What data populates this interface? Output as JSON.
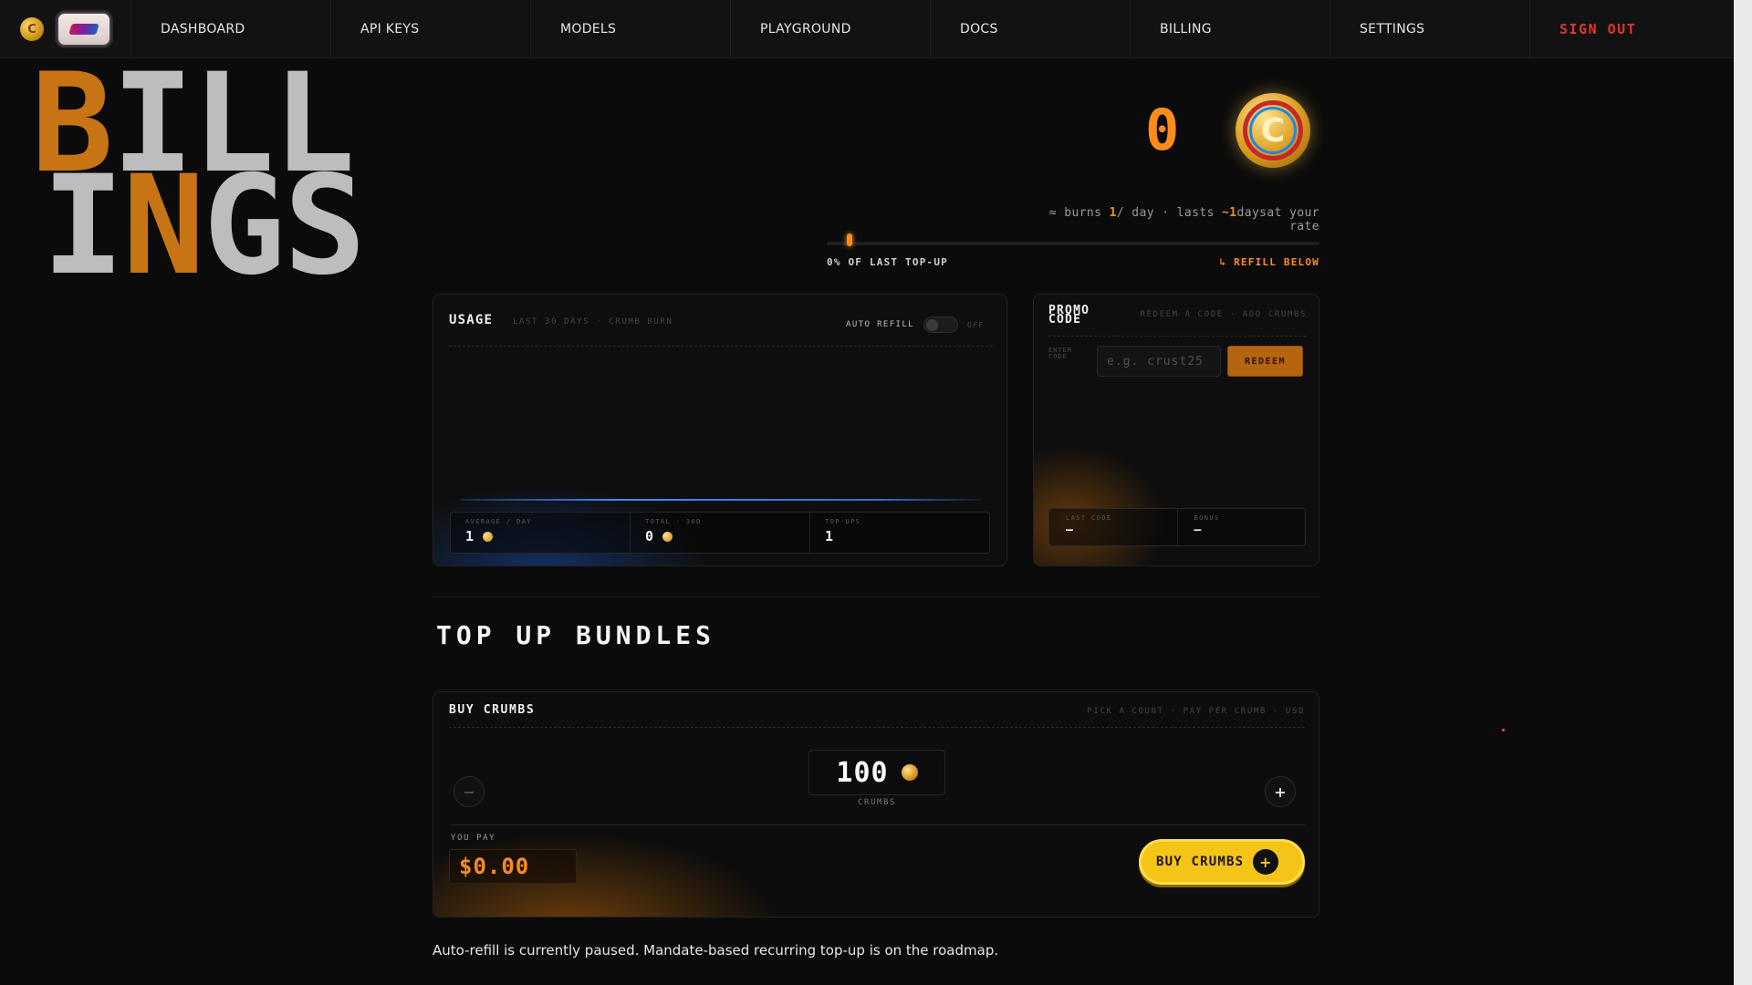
{
  "nav": {
    "items": [
      "DASHBOARD",
      "API KEYS",
      "MODELS",
      "PLAYGROUND",
      "DOCS",
      "BILLING",
      "SETTINGS"
    ],
    "signout": "SIGN OUT",
    "coin_icon": "C"
  },
  "hero": {
    "line1": "BILL",
    "line2": "INGS",
    "accent_color": "#c77414"
  },
  "balance": {
    "value": "0",
    "coin_letter": "C",
    "burn_prefix": "≈ burns ",
    "burn_rate": "1",
    "burn_mid": "/ day · lasts ",
    "lasts_days": "~1",
    "burn_suffix": "daysat your rate",
    "progress_percent": 0,
    "progress_left": "0% OF LAST TOP-UP",
    "progress_right": "↳ REFILL BELOW"
  },
  "usage": {
    "title": "USAGE",
    "subtitle": "LAST 30 DAYS · CRUMB BURN",
    "auto_refill_label": "AUTO REFILL",
    "auto_refill_state": "OFF",
    "stats": [
      {
        "label": "AVERAGE / DAY",
        "value": "1"
      },
      {
        "label": "TOTAL · 30D",
        "value": "0"
      },
      {
        "label": "TOP-UPS",
        "value": "1"
      }
    ]
  },
  "promo": {
    "title": "PROMO CODE",
    "subtitle": "REDEEM A CODE · ADD CRUMBS",
    "input_label": "ENTER CODE",
    "placeholder": "e.g. crust25",
    "redeem_label": "REDEEM",
    "stats": [
      {
        "label": "LAST CODE",
        "value": "—"
      },
      {
        "label": "BONUS",
        "value": "—"
      }
    ]
  },
  "bundles": {
    "section_title": "TOP UP BUNDLES",
    "card_title": "BUY CRUMBS",
    "card_subtitle": "PICK A COUNT · PAY PER CRUMB · USD",
    "minus": "−",
    "plus": "+",
    "quantity": "100",
    "quantity_label": "CRUMBS",
    "pay_label": "YOU PAY",
    "price": "$0.00",
    "buy_label": "BUY CRUMBS",
    "buy_icon": "+"
  },
  "footnote": "Auto-refill is currently paused. Mandate-based recurring top-up is on the roadmap.",
  "colors": {
    "accent": "#ff8c1a",
    "gold": "#f4c516",
    "danger": "#e0352b",
    "chart": "#3d8bff"
  }
}
